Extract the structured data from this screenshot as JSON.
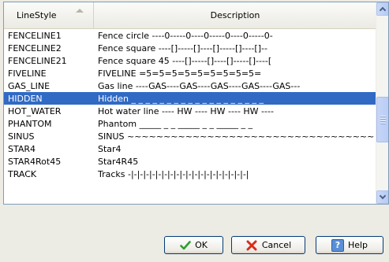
{
  "columns": {
    "line_style": "LineStyle",
    "description": "Description"
  },
  "rows": [
    {
      "name": "FENCELINE1",
      "description": "Fence circle ----0-----0----0-----0----0-----0-"
    },
    {
      "name": "FENCELINE2",
      "description": "Fence square ----[]-----[]----[]-----[]----[]--"
    },
    {
      "name": "FENCELINE21",
      "description": "Fence square 45 ----[]-----[]----[]-----[]----["
    },
    {
      "name": "FIVELINE",
      "description": "FIVELINE =5=5=5=5=5=5=5=5=5="
    },
    {
      "name": "GAS_LINE",
      "description": "Gas line ----GAS----GAS----GAS----GAS----GAS---"
    },
    {
      "name": "HIDDEN",
      "description": "Hidden _ _ _ _ _ _ _ _ _ _ _ _ _ _ _ _ _ _ _"
    },
    {
      "name": "HOT_WATER",
      "description": "Hot water line ---- HW ---- HW ---- HW ----"
    },
    {
      "name": "PHANTOM",
      "description": "Phantom _____ _ _ _____ _ _ _____ _ _"
    },
    {
      "name": "SINUS",
      "description": "SINUS ~~~~~~~~~~~~~~~~~~~~~~~~~~~~~~~~~~"
    },
    {
      "name": "STAR4",
      "description": "Star4"
    },
    {
      "name": "STAR4Rot45",
      "description": "Star4R45"
    },
    {
      "name": "TRACK",
      "description": "Tracks -|-|-|-|-|-|-|-|-|-|-|-|-|-|-|-|-|-|-|-|"
    }
  ],
  "selected_row": "HIDDEN",
  "buttons": {
    "ok": "OK",
    "cancel": "Cancel",
    "help": "Help"
  },
  "icons": {
    "ok": "checkmark-icon",
    "cancel": "red-x-icon",
    "help": "question-mark-icon",
    "sort": "sort-ascending-icon"
  },
  "colors": {
    "selection": "#316ac5",
    "check": "#2f9e2f",
    "cancel_x": "#d92c1a",
    "help": "#5a8fd6",
    "dialog_bg": "#ecebe4"
  }
}
